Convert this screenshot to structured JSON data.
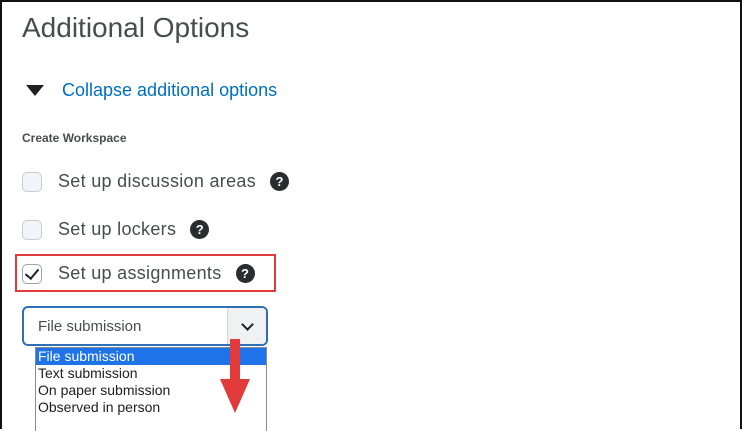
{
  "section_title": "Additional Options",
  "collapse_link": "Collapse additional options",
  "workspace": {
    "label": "Create Workspace",
    "options": [
      {
        "label": "Set up discussion areas",
        "checked": false
      },
      {
        "label": "Set up lockers",
        "checked": false
      },
      {
        "label": "Set up assignments",
        "checked": true
      }
    ],
    "help_glyph": "?"
  },
  "submission_select": {
    "value": "File submission",
    "options": [
      "File submission",
      "Text submission",
      "On paper submission",
      "Observed in person"
    ],
    "selected_index": 0
  },
  "annotation": {
    "highlight_color": "#e03a3a",
    "arrow_color": "#e03a3a"
  },
  "icons": {
    "collapse": "triangle-down-icon",
    "help": "question-circle-icon",
    "dropdown": "chevron-down-icon",
    "arrow": "arrow-down-icon"
  }
}
